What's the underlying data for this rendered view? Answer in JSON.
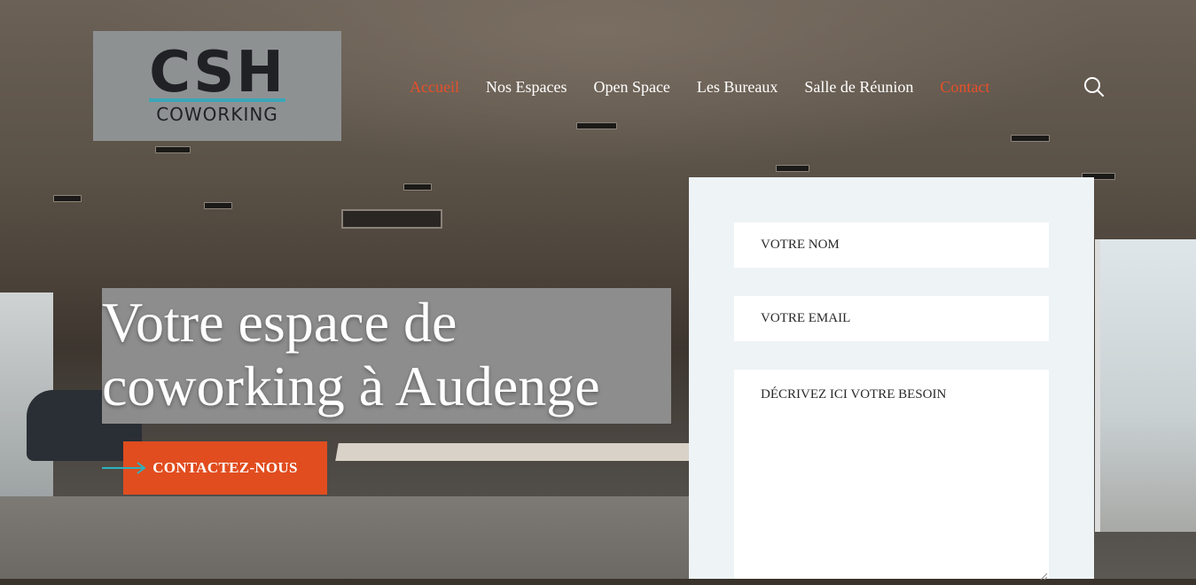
{
  "logo": {
    "mark": "CSH",
    "sub": "COWORKING"
  },
  "nav": {
    "items": [
      {
        "label": "Accueil",
        "active": true
      },
      {
        "label": "Nos Espaces",
        "active": false
      },
      {
        "label": "Open Space",
        "active": false
      },
      {
        "label": "Les Bureaux",
        "active": false
      },
      {
        "label": "Salle de Réunion",
        "active": false
      },
      {
        "label": "Contact",
        "active": true
      }
    ],
    "search_icon": "search-icon"
  },
  "hero": {
    "headline_line1": "Votre espace de",
    "headline_line2": "coworking à Audenge",
    "cta_label": "CONTACTEZ-NOUS",
    "cta_arrow_icon": "arrow-right-icon"
  },
  "form": {
    "name_placeholder": "VOTRE NOM",
    "email_placeholder": "VOTRE EMAIL",
    "need_placeholder": "DÉCRIVEZ ICI VOTRE BESOIN"
  },
  "colors": {
    "accent": "#e14d1f",
    "nav_active": "#e8502a",
    "logo_line": "#3aa6b8",
    "form_bg": "#eef3f6",
    "arrow": "#2bb3c0"
  }
}
